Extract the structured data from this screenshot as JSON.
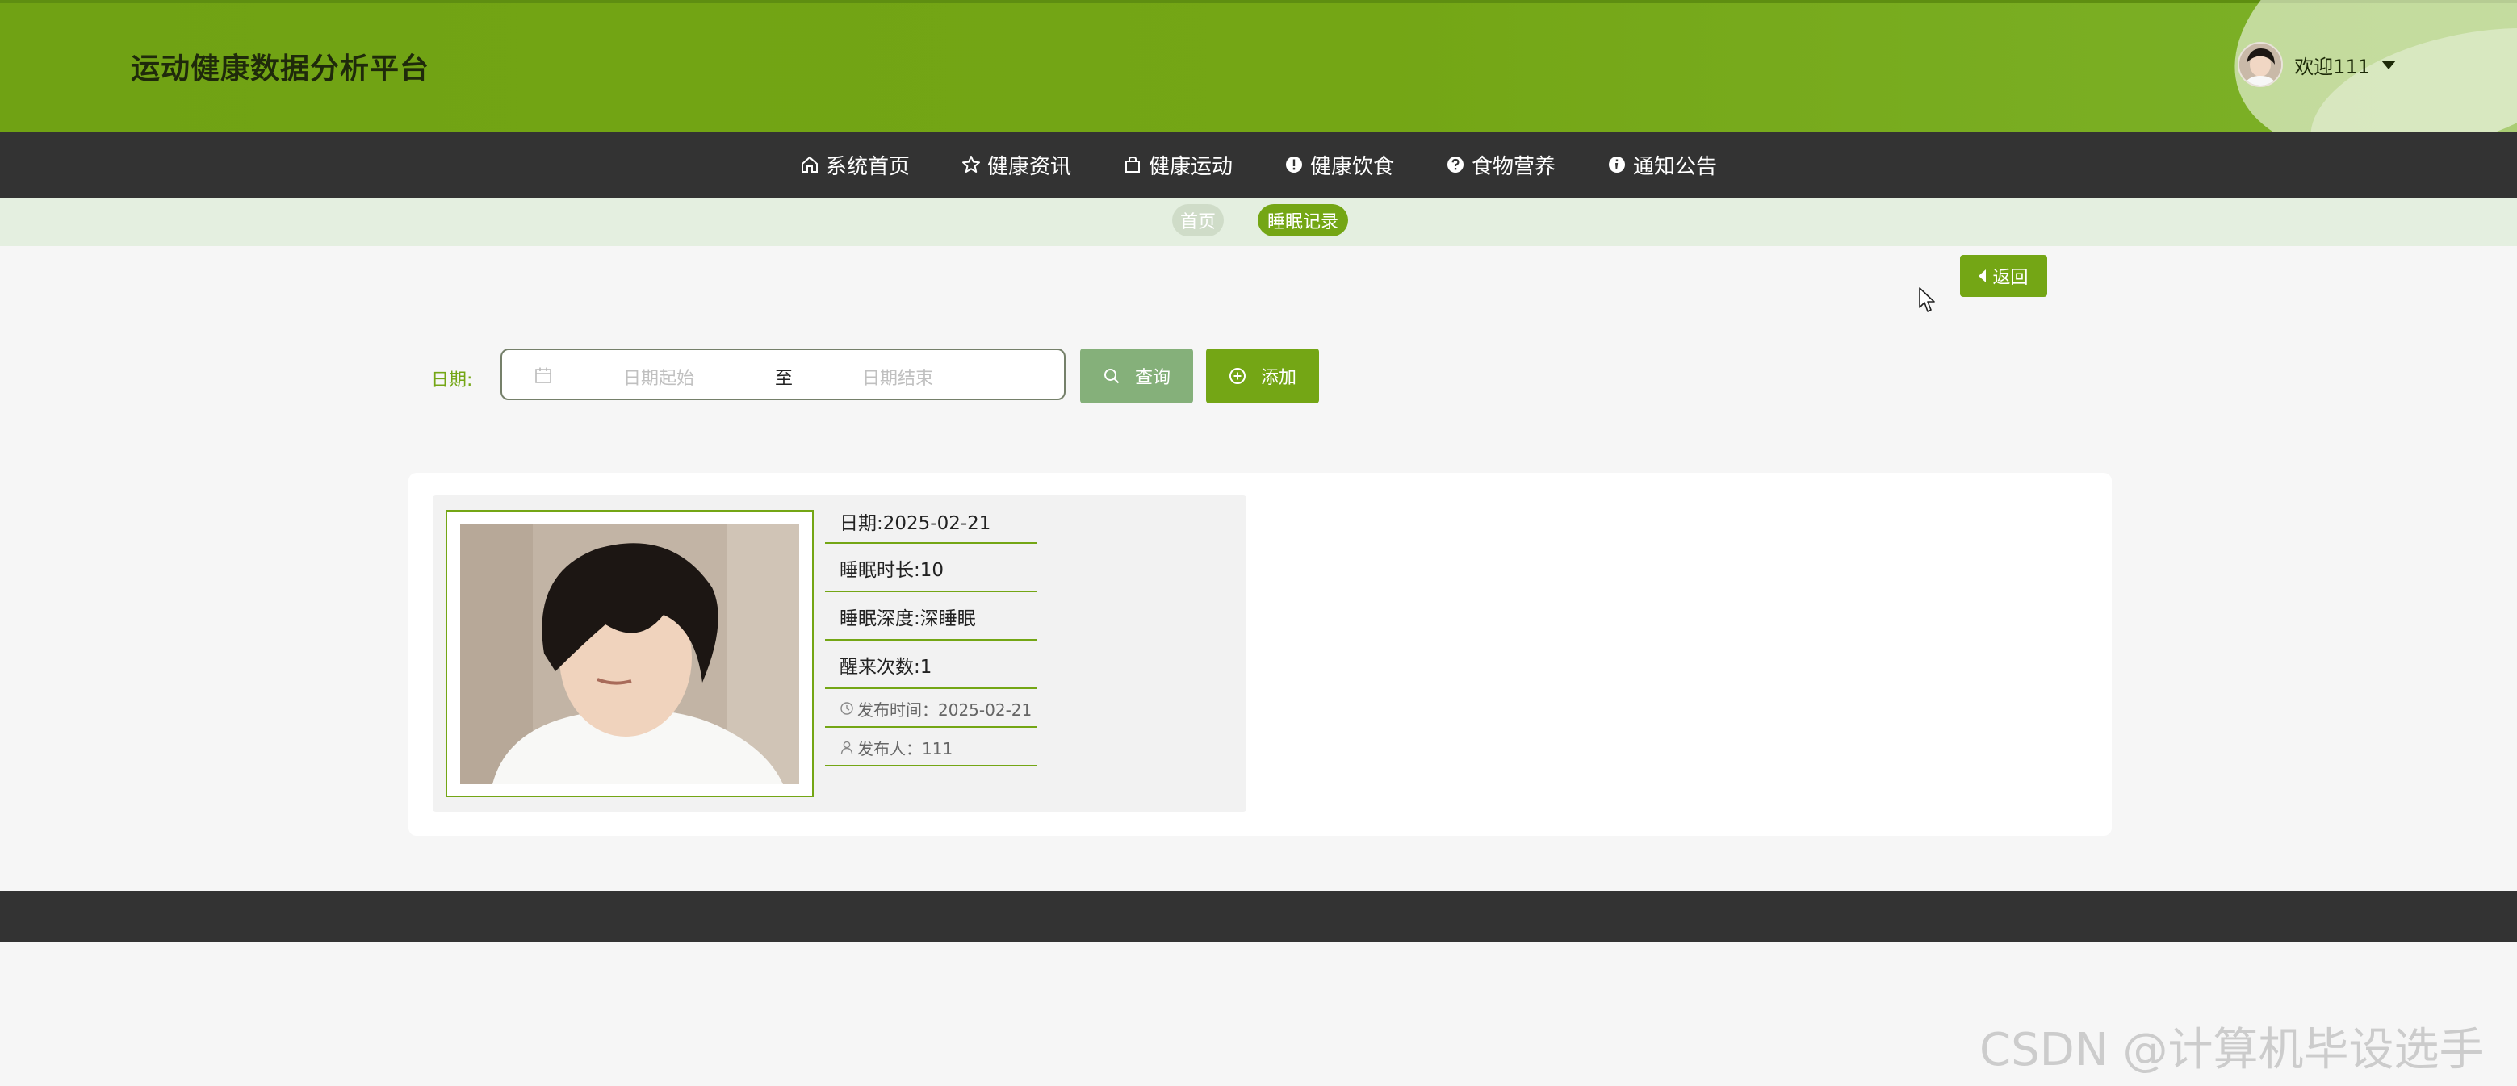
{
  "header": {
    "site_title": "运动健康数据分析平台",
    "welcome": "欢迎111"
  },
  "nav": {
    "items": [
      {
        "label": "系统首页",
        "icon": "home-icon"
      },
      {
        "label": "健康资讯",
        "icon": "star-icon"
      },
      {
        "label": "健康运动",
        "icon": "bag-icon"
      },
      {
        "label": "健康饮食",
        "icon": "exclamation-circle-icon"
      },
      {
        "label": "食物营养",
        "icon": "question-circle-icon"
      },
      {
        "label": "通知公告",
        "icon": "info-circle-icon"
      }
    ]
  },
  "breadcrumb": {
    "home": "首页",
    "current": "睡眠记录"
  },
  "back_button": "返回",
  "search": {
    "date_label": "日期:",
    "start_placeholder": "日期起始",
    "separator": "至",
    "end_placeholder": "日期结束",
    "query_button": "查询",
    "add_button": "添加"
  },
  "records": [
    {
      "date": "日期:2025-02-21",
      "duration": "睡眠时长:10",
      "depth": "睡眠深度:深睡眠",
      "wake_count": "醒来次数:1",
      "publish_time": "发布时间：2025-02-21",
      "publisher": "发布人：111"
    }
  ],
  "watermark": "CSDN @计算机毕设选手",
  "colors": {
    "primary": "#74a615",
    "dark": "#333333",
    "band": "#e4efe0",
    "query": "#85b07a"
  }
}
